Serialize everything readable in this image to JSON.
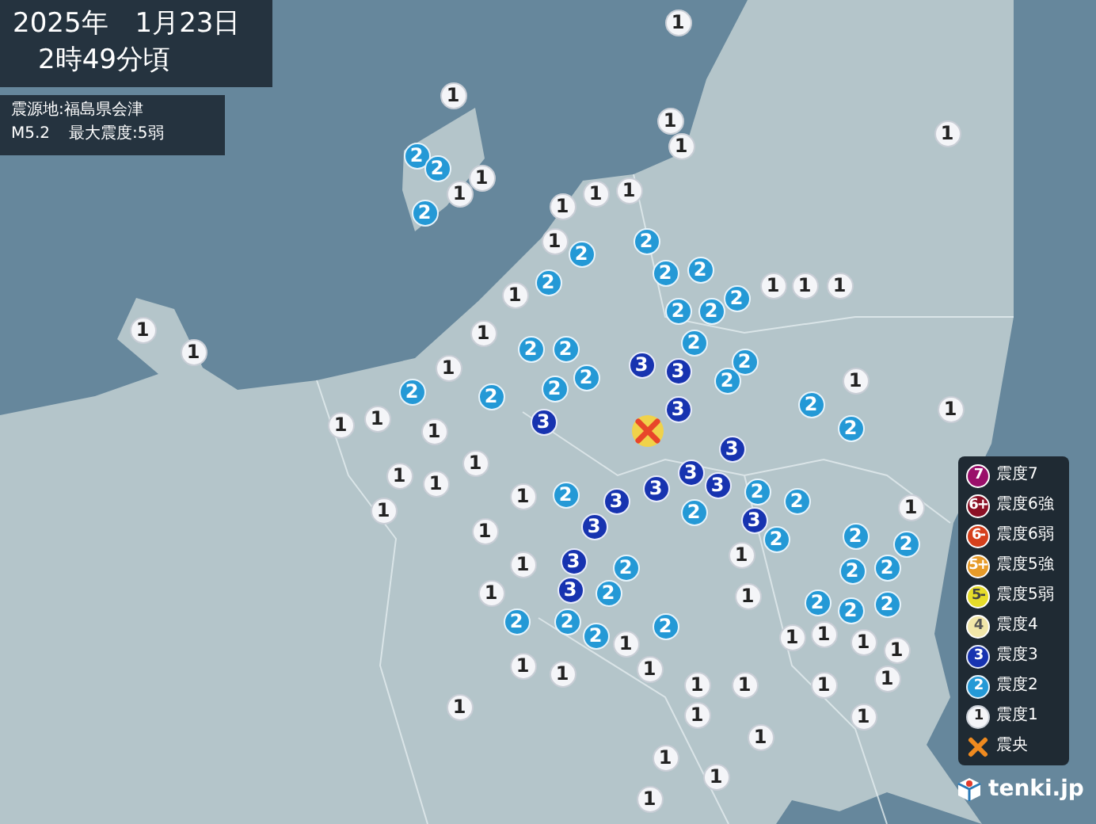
{
  "header": {
    "date": "2025年　1月23日",
    "time": "2時49分頃"
  },
  "info": {
    "epicenter": "震源地:福島県会津",
    "magnitude": "M5.2",
    "max_intensity": "最大震度:5弱"
  },
  "map": {
    "epicenter": {
      "kind": "epicenter"
    },
    "markers": [
      {
        "kind": "s1",
        "label": "1"
      },
      {
        "kind": "s1",
        "label": "1"
      },
      {
        "kind": "s1",
        "label": "1"
      },
      {
        "kind": "s1",
        "label": "1"
      },
      {
        "kind": "s1",
        "label": "1"
      },
      {
        "kind": "s2",
        "label": "2"
      },
      {
        "kind": "s2",
        "label": "2"
      },
      {
        "kind": "s2",
        "label": "2"
      },
      {
        "kind": "s1",
        "label": "1"
      },
      {
        "kind": "s1",
        "label": "1"
      },
      {
        "kind": "s1",
        "label": "1"
      },
      {
        "kind": "s1",
        "label": "1"
      },
      {
        "kind": "s1",
        "label": "1"
      },
      {
        "kind": "s1",
        "label": "1"
      },
      {
        "kind": "s1",
        "label": "1"
      },
      {
        "kind": "s1",
        "label": "1"
      },
      {
        "kind": "s2",
        "label": "2"
      },
      {
        "kind": "s2",
        "label": "2"
      },
      {
        "kind": "s1",
        "label": "1"
      },
      {
        "kind": "s1",
        "label": "1"
      },
      {
        "kind": "s2",
        "label": "2"
      },
      {
        "kind": "s2",
        "label": "2"
      },
      {
        "kind": "s2",
        "label": "2"
      },
      {
        "kind": "s2",
        "label": "2"
      },
      {
        "kind": "s2",
        "label": "2"
      },
      {
        "kind": "s3",
        "label": "3"
      },
      {
        "kind": "s2",
        "label": "2"
      },
      {
        "kind": "s1",
        "label": "1"
      },
      {
        "kind": "s1",
        "label": "1"
      },
      {
        "kind": "s1",
        "label": "1"
      },
      {
        "kind": "s1",
        "label": "1"
      },
      {
        "kind": "s1",
        "label": "1"
      },
      {
        "kind": "s1",
        "label": "1"
      },
      {
        "kind": "s1",
        "label": "1"
      },
      {
        "kind": "s1",
        "label": "1"
      },
      {
        "kind": "s2",
        "label": "2"
      },
      {
        "kind": "s2",
        "label": "2"
      },
      {
        "kind": "s2",
        "label": "2"
      },
      {
        "kind": "s2",
        "label": "2"
      },
      {
        "kind": "s1",
        "label": "1"
      },
      {
        "kind": "s1",
        "label": "1"
      },
      {
        "kind": "s1",
        "label": "1"
      },
      {
        "kind": "s2",
        "label": "2"
      },
      {
        "kind": "s2",
        "label": "2"
      },
      {
        "kind": "s2",
        "label": "2"
      },
      {
        "kind": "s2",
        "label": "2"
      },
      {
        "kind": "s3",
        "label": "3"
      },
      {
        "kind": "s3",
        "label": "3"
      },
      {
        "kind": "s3",
        "label": "3"
      },
      {
        "kind": "s2",
        "label": "2"
      },
      {
        "kind": "s2",
        "label": "2"
      },
      {
        "kind": "s1",
        "label": "1"
      },
      {
        "kind": "s2",
        "label": "2"
      },
      {
        "kind": "s3",
        "label": "3"
      },
      {
        "kind": "s1",
        "label": "1"
      },
      {
        "kind": "s3",
        "label": "3"
      },
      {
        "kind": "s3",
        "label": "3"
      },
      {
        "kind": "s3",
        "label": "3"
      },
      {
        "kind": "s2",
        "label": "2"
      },
      {
        "kind": "s2",
        "label": "2"
      },
      {
        "kind": "s2",
        "label": "2"
      },
      {
        "kind": "s3",
        "label": "3"
      },
      {
        "kind": "s2",
        "label": "2"
      },
      {
        "kind": "s3",
        "label": "3"
      },
      {
        "kind": "s1",
        "label": "1"
      },
      {
        "kind": "s3",
        "label": "3"
      },
      {
        "kind": "s1",
        "label": "1"
      },
      {
        "kind": "s1",
        "label": "1"
      },
      {
        "kind": "s3",
        "label": "3"
      },
      {
        "kind": "s2",
        "label": "2"
      },
      {
        "kind": "s3",
        "label": "3"
      },
      {
        "kind": "s2",
        "label": "2"
      },
      {
        "kind": "s2",
        "label": "2"
      },
      {
        "kind": "s2",
        "label": "2"
      },
      {
        "kind": "s1",
        "label": "1"
      },
      {
        "kind": "s2",
        "label": "2"
      },
      {
        "kind": "s2",
        "label": "2"
      },
      {
        "kind": "s1",
        "label": "1"
      },
      {
        "kind": "s2",
        "label": "2"
      },
      {
        "kind": "s2",
        "label": "2"
      },
      {
        "kind": "s2",
        "label": "2"
      },
      {
        "kind": "s2",
        "label": "2"
      },
      {
        "kind": "s2",
        "label": "2"
      },
      {
        "kind": "s1",
        "label": "1"
      },
      {
        "kind": "s2",
        "label": "2"
      },
      {
        "kind": "s2",
        "label": "2"
      },
      {
        "kind": "s2",
        "label": "2"
      },
      {
        "kind": "s1",
        "label": "1"
      },
      {
        "kind": "s1",
        "label": "1"
      },
      {
        "kind": "s1",
        "label": "1"
      },
      {
        "kind": "s1",
        "label": "1"
      },
      {
        "kind": "s1",
        "label": "1"
      },
      {
        "kind": "s1",
        "label": "1"
      },
      {
        "kind": "s1",
        "label": "1"
      },
      {
        "kind": "s1",
        "label": "1"
      },
      {
        "kind": "s1",
        "label": "1"
      },
      {
        "kind": "s1",
        "label": "1"
      },
      {
        "kind": "s1",
        "label": "1"
      },
      {
        "kind": "s1",
        "label": "1"
      },
      {
        "kind": "s1",
        "label": "1"
      },
      {
        "kind": "s1",
        "label": "1"
      },
      {
        "kind": "s1",
        "label": "1"
      },
      {
        "kind": "s1",
        "label": "1"
      },
      {
        "kind": "s1",
        "label": "1"
      },
      {
        "kind": "s1",
        "label": "1"
      },
      {
        "kind": "s1",
        "label": "1"
      },
      {
        "kind": "s1",
        "label": "1"
      }
    ]
  },
  "legend": [
    {
      "kind": "s7",
      "symbol": "7",
      "label": "震度7"
    },
    {
      "kind": "s6p",
      "symbol": "6+",
      "label": "震度6強"
    },
    {
      "kind": "s6m",
      "symbol": "6-",
      "label": "震度6弱"
    },
    {
      "kind": "s5p",
      "symbol": "5+",
      "label": "震度5強"
    },
    {
      "kind": "s5m",
      "symbol": "5-",
      "label": "震度5弱"
    },
    {
      "kind": "s4",
      "symbol": "4",
      "label": "震度4"
    },
    {
      "kind": "s3",
      "symbol": "3",
      "label": "震度3"
    },
    {
      "kind": "s2",
      "symbol": "2",
      "label": "震度2"
    },
    {
      "kind": "s1",
      "symbol": "1",
      "label": "震度1"
    },
    {
      "kind": "epicenter",
      "label": "震央"
    }
  ],
  "logo": {
    "text": "tenki.jp"
  }
}
